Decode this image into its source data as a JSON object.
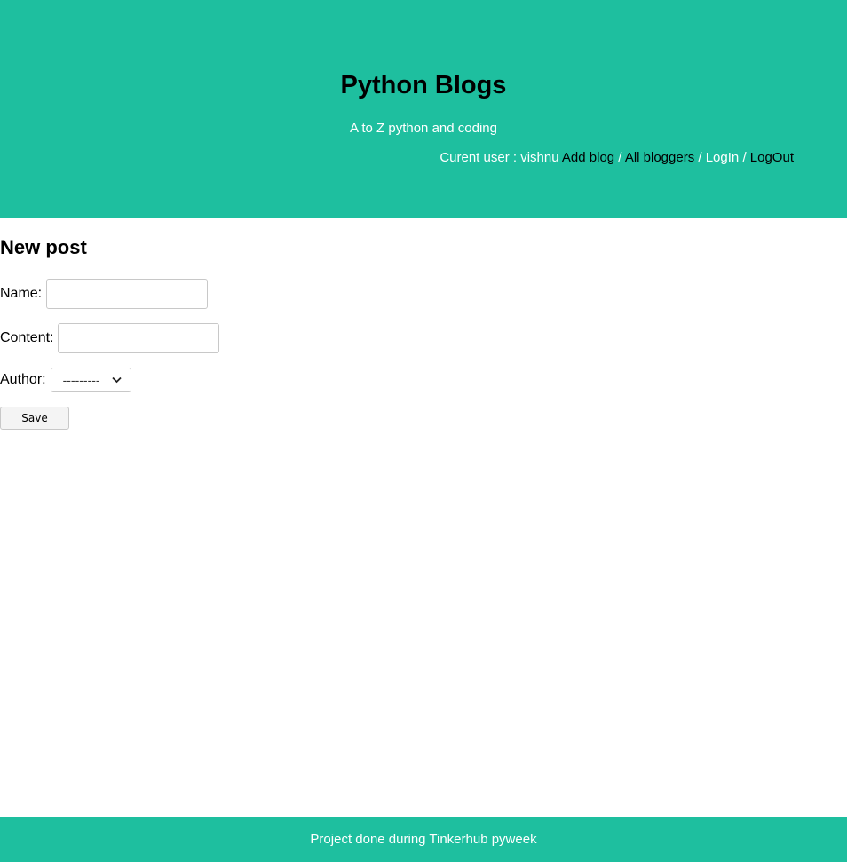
{
  "header": {
    "title": "Python Blogs",
    "tagline": "A to Z python and coding",
    "current_user": "Curent user : vishnu",
    "nav": {
      "add_blog": "Add blog",
      "sep1": "/",
      "all_bloggers": "All bloggers",
      "sep2": "/",
      "login": "LogIn",
      "sep3": "/",
      "logout": "LogOut"
    }
  },
  "form": {
    "title": "New post",
    "name_label": "Name:",
    "name_value": "",
    "content_label": "Content:",
    "content_value": "",
    "author_label": "Author:",
    "author_selected": "---------",
    "save_label": "Save"
  },
  "footer": {
    "text": "Project done during Tinkerhub pyweek"
  },
  "colors": {
    "accent": "#1ebf9f"
  }
}
